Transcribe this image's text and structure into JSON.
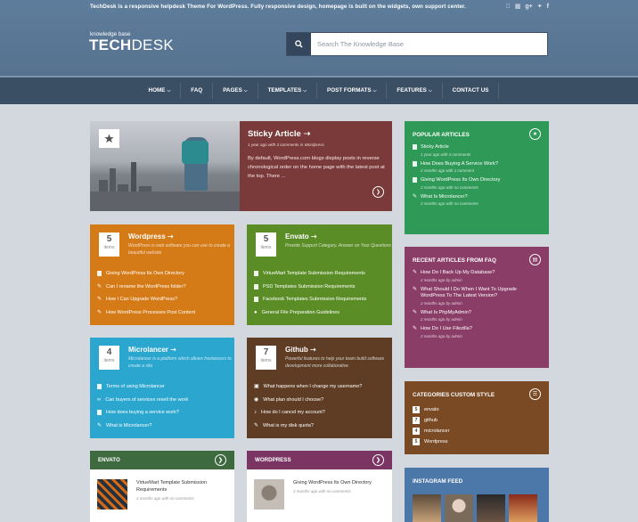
{
  "header": {
    "tagline": "TechDesk is a responsive helpdesk Theme For WordPress. Fully responsive design, homepage is built on the widgets, own support center.",
    "logo_sub": "knowledge base",
    "logo_bold": "TECH",
    "logo_light": "DESK",
    "search_placeholder": "Search The Knowledge Base",
    "social_icons": [
      "apple-icon",
      "windows-icon",
      "google-plus-icon",
      "twitter-icon",
      "facebook-icon"
    ]
  },
  "nav": [
    {
      "label": "HOME",
      "dropdown": true
    },
    {
      "label": "FAQ",
      "dropdown": false
    },
    {
      "label": "PAGES",
      "dropdown": true
    },
    {
      "label": "TEMPLATES",
      "dropdown": true
    },
    {
      "label": "POST FORMATS",
      "dropdown": true
    },
    {
      "label": "FEATURES",
      "dropdown": true
    },
    {
      "label": "CONTACT US",
      "dropdown": false
    }
  ],
  "sticky": {
    "title": "Sticky Article",
    "meta": "1 year ago with 3 comments in Wordpress",
    "text": "By default, WordPress.com blogs display posts in reverse chronological order on the home page with the latest post at the top. There ..."
  },
  "categories": [
    {
      "count": "5",
      "count_label": "items",
      "title": "Wordpress",
      "desc": "WordPress is web software you can use to create a beautiful website",
      "items": [
        "Giving WordPress Its Own Directory",
        "Can I rename the WordPress folder?",
        "How I Can Upgrade WordPress?",
        "How WordPress Processes Post Content"
      ],
      "color": "#d47a17"
    },
    {
      "count": "5",
      "count_label": "items",
      "title": "Envato",
      "desc": "Provide Support Category. Answer on Your Questions",
      "items": [
        "VirtueMart Template Submission Requirements",
        "PSD Templates Submission Requirements",
        "Facebook Templates Submission Requirements",
        "General File Preparation Guidelines"
      ],
      "color": "#5b8d27"
    },
    {
      "count": "4",
      "count_label": "items",
      "title": "Microlancer",
      "desc": "Microlancer is a platform which allows freelancers to create a site",
      "items": [
        "Terms of using Microlancer",
        "Can buyers of services resell the work",
        "How does buying a service work?",
        "What is Microlancer?"
      ],
      "color": "#2ba6cf"
    },
    {
      "count": "7",
      "count_label": "items",
      "title": "Github",
      "desc": "Powerful features to help your team build software development more collaborative",
      "items": [
        "What happens when I change my username?",
        "What plan should I choose?",
        "How do I cancel my account?",
        "What is my disk quota?"
      ],
      "color": "#5e3d24"
    }
  ],
  "popular": {
    "title": "POPULAR ARTICLES",
    "items": [
      {
        "title": "Sticky Article",
        "meta": "1 year ago with 3 comments"
      },
      {
        "title": "How Does Buying A Service Work?",
        "meta": "2 months ago with 1 comment"
      },
      {
        "title": "Giving WordPress Its Own Directory",
        "meta": "2 months ago with no comments"
      },
      {
        "title": "What Is Microlancer?",
        "meta": "2 months ago with no comments"
      }
    ]
  },
  "recent": {
    "title": "RECENT ARTICLES FROM FAQ",
    "items": [
      {
        "title": "How Do I Back Up My Database?",
        "meta": "2 months ago by admin"
      },
      {
        "title": "What Should I Do When I Want To Upgrade WordPress To The Latest Version?",
        "meta": "2 months ago by admin"
      },
      {
        "title": "What Is PhpMyAdmin?",
        "meta": "2 months ago by admin"
      },
      {
        "title": "How Do I Use Filezilla?",
        "meta": "2 months ago by admin"
      }
    ]
  },
  "cat_style": {
    "title": "CATEGORIES CUSTOM STYLE",
    "items": [
      {
        "n": "5",
        "label": "envato"
      },
      {
        "n": "7",
        "label": "github"
      },
      {
        "n": "4",
        "label": "microlancer"
      },
      {
        "n": "5",
        "label": "Wordpress"
      }
    ]
  },
  "envato_bar": {
    "title": "ENVATO",
    "post": "VirtueMart Template Submission Requirements",
    "meta": "2 months ago with no comments"
  },
  "wordpress_bar": {
    "title": "WORDPRESS",
    "post": "Giving WordPress Its Own Directory",
    "meta": "2 months ago with no comments"
  },
  "instagram": {
    "title": "INSTAGRAM FEED"
  },
  "colors": {
    "sticky": "#7a3a3a",
    "popular": "#2f9a57",
    "recent": "#8a3d67",
    "catstyle": "#7a4a24",
    "insta": "#4b78a8"
  }
}
